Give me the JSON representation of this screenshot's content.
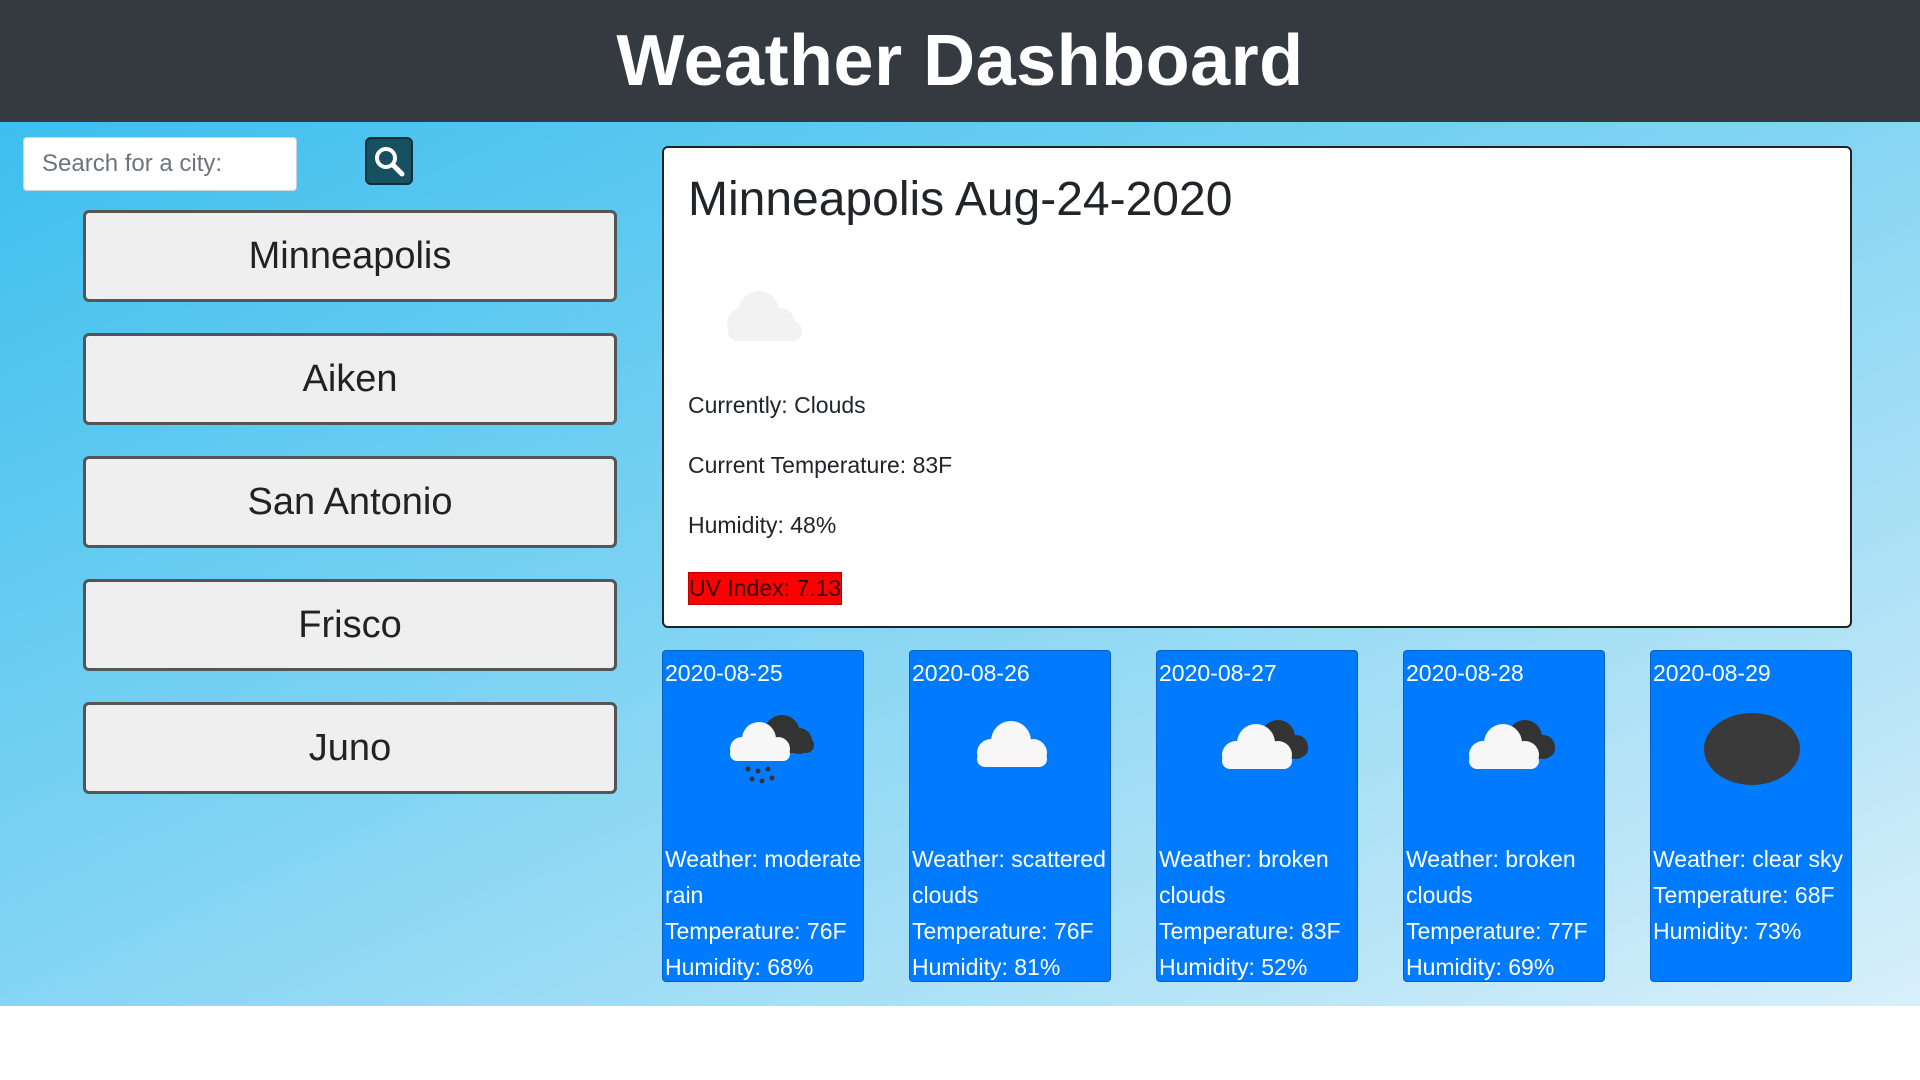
{
  "header": {
    "title": "Weather Dashboard"
  },
  "search": {
    "placeholder": "Search for a city:",
    "button_icon": "search-icon"
  },
  "cities": [
    "Minneapolis",
    "Aiken",
    "San Antonio",
    "Frisco",
    "Juno"
  ],
  "current": {
    "title": "Minneapolis Aug-24-2020",
    "icon": "cloud-icon",
    "conditions": "Currently: Clouds",
    "temperature": "Current Temperature: 83F",
    "humidity": "Humidity: 48%",
    "uv": "UV Index: 7.13",
    "uv_color": "#ff0000"
  },
  "forecast": [
    {
      "date": "2020-08-25",
      "icon": "rain-icon",
      "weather": "Weather: moderate rain",
      "temperature": "Temperature: 76F",
      "humidity": "Humidity: 68%"
    },
    {
      "date": "2020-08-26",
      "icon": "scattered-clouds-icon",
      "weather": "Weather: scattered clouds",
      "temperature": "Temperature: 76F",
      "humidity": "Humidity: 81%"
    },
    {
      "date": "2020-08-27",
      "icon": "broken-clouds-icon",
      "weather": "Weather: broken clouds",
      "temperature": "Temperature: 83F",
      "humidity": "Humidity: 52%"
    },
    {
      "date": "2020-08-28",
      "icon": "broken-clouds-icon",
      "weather": "Weather: broken clouds",
      "temperature": "Temperature: 77F",
      "humidity": "Humidity: 69%"
    },
    {
      "date": "2020-08-29",
      "icon": "clear-sky-icon",
      "weather": "Weather: clear sky",
      "temperature": "Temperature: 68F",
      "humidity": "Humidity: 73%"
    }
  ],
  "colors": {
    "header_bg": "#343a40",
    "forecast_card": "#007bff",
    "search_button": "#17505f"
  }
}
